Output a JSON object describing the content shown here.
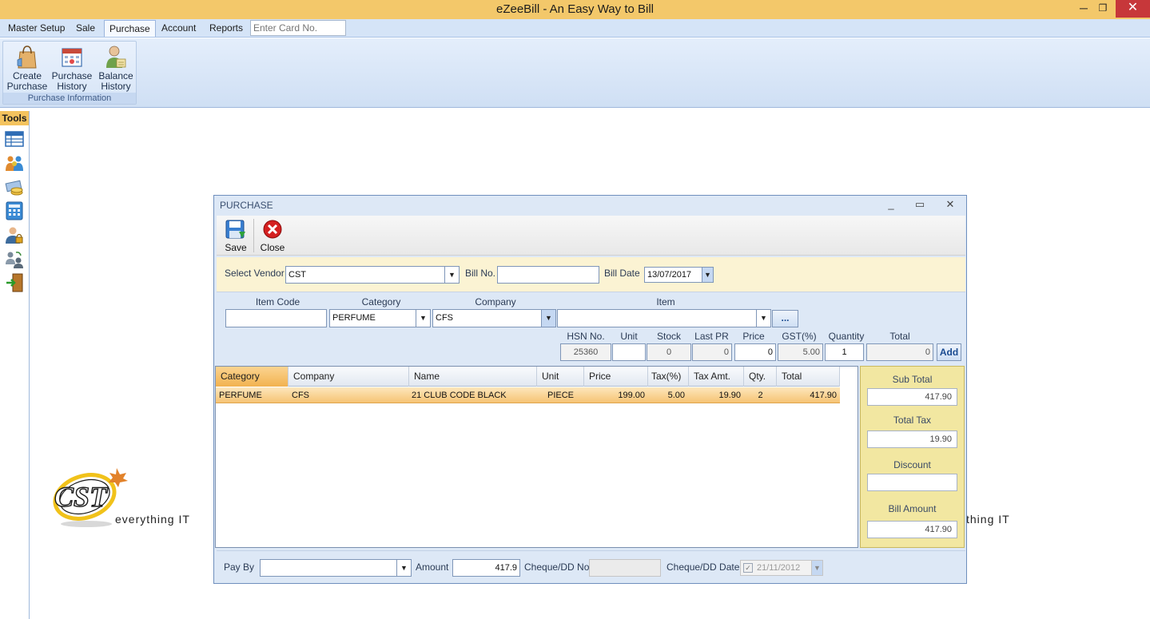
{
  "window": {
    "title": "eZeeBill - An Easy Way to Bill",
    "controls": {
      "minimize": "─",
      "restore": "❐",
      "close": "✕"
    }
  },
  "menu": {
    "items": [
      "Master Setup",
      "Sale",
      "Purchase",
      "Account",
      "Reports"
    ],
    "active": "Purchase",
    "card_placeholder": "Enter Card No."
  },
  "ribbon": {
    "group_label": "Purchase Information",
    "buttons": [
      {
        "line1": "Create",
        "line2": "Purchase",
        "icon": "shopping-bag-icon"
      },
      {
        "line1": "Purchase",
        "line2": "History",
        "icon": "calendar-history-icon"
      },
      {
        "line1": "Balance",
        "line2": "History",
        "icon": "user-balance-icon"
      }
    ]
  },
  "tools": {
    "label": "Tools",
    "icons": [
      "table-icon",
      "users-icon",
      "money-icon",
      "calculator-icon",
      "user-lock-icon",
      "user-sync-icon",
      "exit-door-icon"
    ]
  },
  "logo": {
    "brand": "CST",
    "tagline": "everything IT",
    "tagline_clipped": "thing IT"
  },
  "dialog": {
    "title": "PURCHASE",
    "controls": {
      "minimize": "_",
      "maximize": "▭",
      "close": "✕"
    },
    "toolbar": {
      "save": "Save",
      "close": "Close"
    },
    "vendor": {
      "select_vendor_label": "Select Vendor",
      "vendor_value": "CST",
      "bill_no_label": "Bill No.",
      "bill_no_value": "",
      "bill_date_label": "Bill Date",
      "bill_date_value": "13/07/2017"
    },
    "item_entry": {
      "item_code_label": "Item Code",
      "category_label": "Category",
      "company_label": "Company",
      "item_label": "Item",
      "item_code_value": "",
      "category_value": "PERFUME",
      "company_value": "CFS",
      "item_value": "",
      "more_button": "...",
      "hsn_label": "HSN No.",
      "unit_label": "Unit",
      "stock_label": "Stock",
      "last_pr_label": "Last PR",
      "price_label": "Price",
      "gst_label": "GST(%)",
      "quantity_label": "Quantity",
      "total_label": "Total",
      "hsn_value": "25360",
      "unit_value": "",
      "stock_value": "0",
      "last_pr_value": "0",
      "price_value": "0",
      "gst_value": "5.00",
      "quantity_value": "1",
      "total_value": "0",
      "add_button": "Add"
    },
    "grid": {
      "headers": [
        "Category",
        "Company",
        "Name",
        "Unit",
        "Price",
        "Tax(%)",
        "Tax Amt.",
        "Qty.",
        "Total"
      ],
      "rows": [
        {
          "category": "PERFUME",
          "company": "CFS",
          "name": "21 CLUB CODE BLACK",
          "unit": "PIECE",
          "price": "199.00",
          "tax_pct": "5.00",
          "tax_amt": "19.90",
          "qty": "2",
          "total": "417.90"
        }
      ]
    },
    "totals": {
      "sub_total_label": "Sub Total",
      "sub_total_value": "417.90",
      "total_tax_label": "Total Tax",
      "total_tax_value": "19.90",
      "discount_label": "Discount",
      "discount_value": "",
      "bill_amount_label": "Bill Amount",
      "bill_amount_value": "417.90"
    },
    "footer": {
      "pay_by_label": "Pay By",
      "pay_by_value": "",
      "amount_label": "Amount",
      "amount_value": "417.9",
      "cheque_no_label": "Cheque/DD No.",
      "cheque_no_value": "",
      "cheque_date_label": "Cheque/DD Date",
      "cheque_date_value": "21/11/2012"
    }
  },
  "colors": {
    "title_bar": "#f3c86a",
    "ribbon": "#d5e4f7",
    "selected_row": "#f6c374",
    "totals_panel": "#f2e7a1",
    "vendor_panel": "#fbf3d3"
  }
}
